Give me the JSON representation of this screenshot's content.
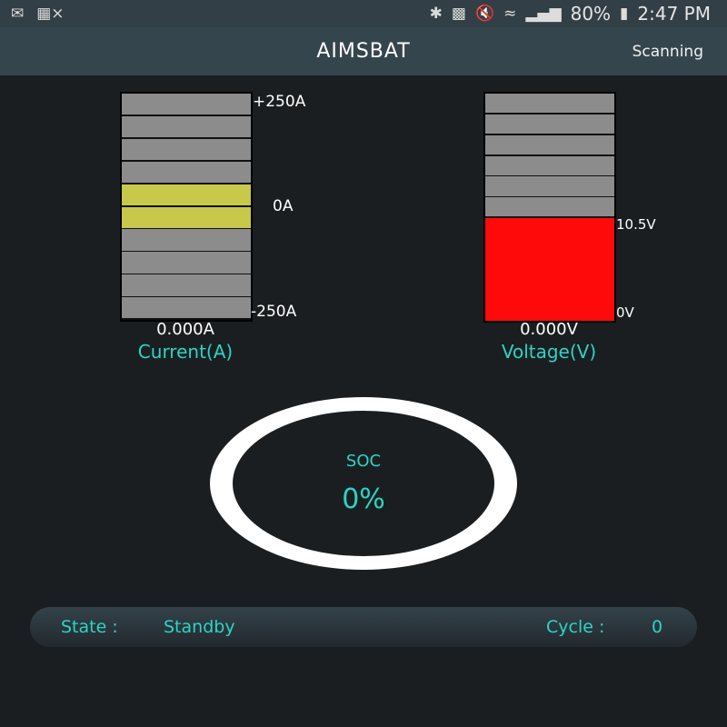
{
  "status_bar": {
    "left_icons": [
      "email-icon",
      "sim-card-off-icon"
    ],
    "right_icons": [
      "bluetooth-icon",
      "nfc-icon",
      "mute-icon",
      "wifi-icon",
      "signal-icon"
    ],
    "battery": "80%",
    "time": "2:47 PM"
  },
  "app_bar": {
    "title": "AIMSBAT",
    "status": "Scanning"
  },
  "current_gauge": {
    "max_label": "+250A",
    "zero_label": "0A",
    "min_label": "-250A",
    "value": "0.000A",
    "caption": "Current(A)",
    "segments": 10,
    "active_segments": [
      4,
      5
    ],
    "active_color": "#c8c84a",
    "inactive_color": "#8c8c8c"
  },
  "voltage_gauge": {
    "threshold_label": "10.5V",
    "min_label": "0V",
    "value": "0.000V",
    "caption": "Voltage(V)",
    "upper_segments": 6,
    "low_zone_color": "#ff0a0a",
    "inactive_color": "#8c8c8c"
  },
  "soc": {
    "label": "SOC",
    "value": "0%",
    "percent": 0
  },
  "state_bar": {
    "state_label": "State :",
    "state_value": "Standby",
    "cycle_label": "Cycle :",
    "cycle_value": "0"
  },
  "colors": {
    "accent": "#2dd4c4",
    "background": "#1b1e21",
    "appbar": "#35454d"
  }
}
